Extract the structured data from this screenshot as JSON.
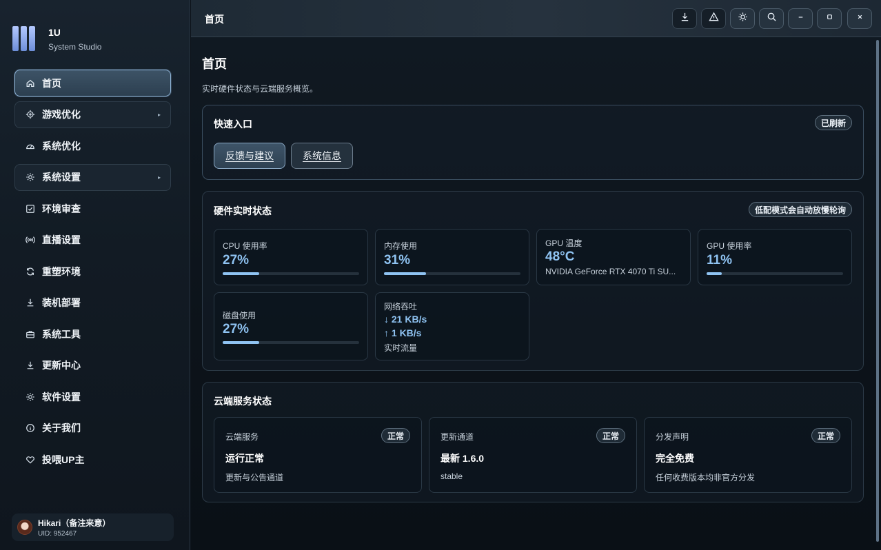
{
  "brand": {
    "name": "1U",
    "subtitle": "System Studio"
  },
  "sidebar": {
    "items": [
      {
        "label": "首页",
        "icon": "home-icon",
        "active": true,
        "expandable": false
      },
      {
        "label": "游戏优化",
        "icon": "crosshair-icon",
        "active": false,
        "expandable": true
      },
      {
        "label": "系统优化",
        "icon": "gauge-icon",
        "active": false,
        "expandable": false
      },
      {
        "label": "系统设置",
        "icon": "gear-icon",
        "active": false,
        "expandable": true
      },
      {
        "label": "环境审查",
        "icon": "checkbox-icon",
        "active": false,
        "expandable": false
      },
      {
        "label": "直播设置",
        "icon": "broadcast-icon",
        "active": false,
        "expandable": false
      },
      {
        "label": "重塑环境",
        "icon": "refresh-icon",
        "active": false,
        "expandable": false
      },
      {
        "label": "装机部署",
        "icon": "download-icon",
        "active": false,
        "expandable": false
      },
      {
        "label": "系统工具",
        "icon": "toolbox-icon",
        "active": false,
        "expandable": false
      },
      {
        "label": "更新中心",
        "icon": "download-icon",
        "active": false,
        "expandable": false
      },
      {
        "label": "软件设置",
        "icon": "gear-icon",
        "active": false,
        "expandable": false
      },
      {
        "label": "关于我们",
        "icon": "info-icon",
        "active": false,
        "expandable": false
      },
      {
        "label": "投喂UP主",
        "icon": "heart-icon",
        "active": false,
        "expandable": false
      }
    ],
    "caret": "▸"
  },
  "user": {
    "name": "Hikari（备注来意）",
    "uid": "UID: 952467"
  },
  "topbar": {
    "title": "首页",
    "buttons": [
      "download-icon",
      "warning-icon",
      "sun-icon",
      "search-icon",
      "minimize-icon",
      "maximize-icon",
      "close-icon"
    ]
  },
  "page": {
    "title": "首页",
    "subtitle": "实时硬件状态与云端服务概览。"
  },
  "quick": {
    "title": "快速入口",
    "badge": "已刷新",
    "buttons": [
      "反馈与建议",
      "系统信息"
    ]
  },
  "hardware": {
    "title": "硬件实时状态",
    "badge": "低配模式会自动放慢轮询",
    "cpu": {
      "label": "CPU 使用率",
      "value": "27%",
      "level": 27
    },
    "mem": {
      "label": "内存使用",
      "value": "31%",
      "level": 31
    },
    "gpu_temp": {
      "label": "GPU 温度",
      "value": "48°C",
      "model": "NVIDIA GeForce RTX 4070 Ti SU..."
    },
    "gpu_usage": {
      "label": "GPU 使用率",
      "value": "11%",
      "level": 11
    },
    "disk": {
      "label": "磁盘使用",
      "value": "27%",
      "level": 27
    },
    "network": {
      "label": "网络吞吐",
      "down": "↓ 21 KB/s",
      "up": "↑ 1 KB/s",
      "note": "实时流量"
    }
  },
  "cloud": {
    "title": "云端服务状态",
    "services": [
      {
        "label": "云端服务",
        "badge": "正常",
        "status": "运行正常",
        "sub": "更新与公告通道"
      },
      {
        "label": "更新通道",
        "badge": "正常",
        "status": "最新 1.6.0",
        "sub": "stable"
      },
      {
        "label": "分发声明",
        "badge": "正常",
        "status": "完全免费",
        "sub": "任何收费版本均非官方分发"
      }
    ]
  },
  "colors": {
    "accent": "#8fc3f2",
    "active_border": "#8eb3d6"
  }
}
